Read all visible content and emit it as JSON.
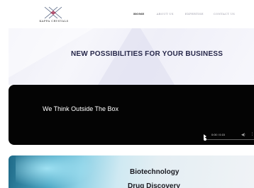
{
  "header": {
    "logo_text": "KAPPA CRYSTALS",
    "nav": [
      {
        "label": "HOME",
        "active": true
      },
      {
        "label": "ABOUT US",
        "active": false
      },
      {
        "label": "EXPERTISE",
        "active": false
      },
      {
        "label": "CONTACT US",
        "active": false
      },
      {
        "label": "",
        "active": false
      }
    ]
  },
  "hero": {
    "title": "NEW POSSIBILITIES FOR YOUR BUSINESS"
  },
  "video": {
    "caption": "We Think Outside The Box",
    "time": "0:00 / 0:15",
    "progress": 0
  },
  "banner": {
    "line1": "Biotechnology",
    "line2": "Drug Discovery"
  },
  "colors": {
    "brand_dark": "#27284a",
    "video_bg": "#040404"
  }
}
